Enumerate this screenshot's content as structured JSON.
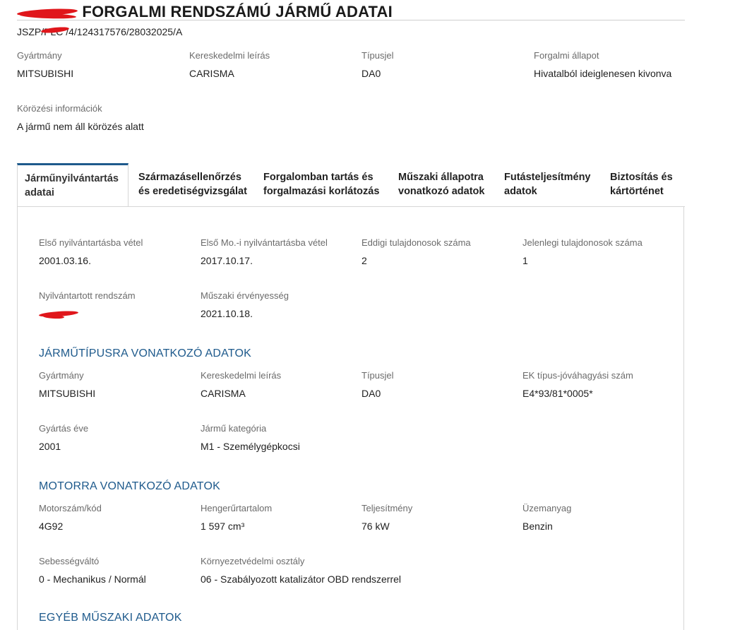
{
  "header": {
    "title_suffix": "FORGALMI RENDSZÁMÚ JÁRMŰ ADATAI",
    "id_line": "JSZP/PLC  /4/124317576/28032025/A"
  },
  "summary": {
    "fields": [
      {
        "label": "Gyártmány",
        "value": "MITSUBISHI"
      },
      {
        "label": "Kereskedelmi leírás",
        "value": "CARISMA"
      },
      {
        "label": "Típusjel",
        "value": "DA0"
      },
      {
        "label": "Forgalmi állapot",
        "value": "Hivatalból ideiglenesen kivonva"
      }
    ],
    "wanted_label": "Körözési információk",
    "wanted_value": "A jármű nem áll körözés alatt"
  },
  "tabs": [
    {
      "line1": "Járműnyilvántartás",
      "line2": "adatai"
    },
    {
      "line1": "Származásellenőrzés",
      "line2": "és eredetiségvizsgálat"
    },
    {
      "line1": "Forgalomban tartás és",
      "line2": "forgalmazási korlátozás"
    },
    {
      "line1": "Műszaki állapotra",
      "line2": "vonatkozó adatok"
    },
    {
      "line1": "Futásteljesítmény",
      "line2": "adatok"
    },
    {
      "line1": "Biztosítás és",
      "line2": "kártörténet"
    }
  ],
  "registry": {
    "first_reg": {
      "label": "Első nyilvántartásba vétel",
      "value": "2001.03.16."
    },
    "first_hu_reg": {
      "label": "Első Mo.-i nyilvántartásba vétel",
      "value": "2017.10.17."
    },
    "prev_owners": {
      "label": "Eddigi tulajdonosok száma",
      "value": "2"
    },
    "current_owners": {
      "label": "Jelenlegi tulajdonosok száma",
      "value": "1"
    },
    "plate": {
      "label": "Nyilvántartott rendszám"
    },
    "validity": {
      "label": "Műszaki érvényesség",
      "value": "2021.10.18."
    }
  },
  "vehicle_type": {
    "heading": "JÁRMŰTÍPUSRA VONATKOZÓ ADATOK",
    "make": {
      "label": "Gyártmány",
      "value": "MITSUBISHI"
    },
    "model": {
      "label": "Kereskedelmi leírás",
      "value": "CARISMA"
    },
    "type": {
      "label": "Típusjel",
      "value": "DA0"
    },
    "ek": {
      "label": "EK típus-jóváhagyási szám",
      "value": "E4*93/81*0005*"
    },
    "year": {
      "label": "Gyártás éve",
      "value": "2001"
    },
    "category": {
      "label": "Jármű kategória",
      "value": "M1 - Személygépkocsi"
    }
  },
  "engine": {
    "heading": "MOTORRA VONATKOZÓ ADATOK",
    "code": {
      "label": "Motorszám/kód",
      "value": "4G92"
    },
    "displacement": {
      "label": "Hengerűrtartalom",
      "value": "1 597 cm³"
    },
    "power": {
      "label": "Teljesítmény",
      "value": "76 kW"
    },
    "fuel": {
      "label": "Üzemanyag",
      "value": "Benzin"
    },
    "gearbox": {
      "label": "Sebességváltó",
      "value": "0 - Mechanikus / Normál"
    },
    "emission": {
      "label": "Környezetvédelmi osztály",
      "value": "06 - Szabályozott katalizátor OBD rendszerrel"
    }
  },
  "other": {
    "heading": "EGYÉB MŰSZAKI ADATOK"
  },
  "colors": {
    "accent": "#1e5a8c",
    "redaction": "#e0161b"
  }
}
